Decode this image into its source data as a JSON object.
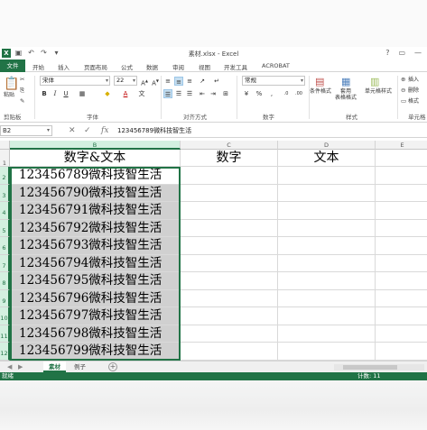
{
  "window": {
    "app_icon": "X",
    "title": "素材.xlsx - Excel",
    "controls": [
      "?",
      "▭",
      "—"
    ]
  },
  "quick_access": {
    "icons": [
      "save-icon",
      "undo-icon",
      "redo-icon",
      "customize-icon"
    ]
  },
  "ribbon": {
    "tabs": [
      "文件",
      "开始",
      "插入",
      "页面布局",
      "公式",
      "数据",
      "审阅",
      "视图",
      "开发工具",
      "ACROBAT"
    ],
    "active_tab": "开始",
    "clipboard": {
      "paste_label": "粘贴",
      "group_label": "剪贴板"
    },
    "font": {
      "name": "宋体",
      "size": "22",
      "group_label": "字体"
    },
    "alignment": {
      "group_label": "对齐方式"
    },
    "number": {
      "format": "常规",
      "group_label": "数字"
    },
    "styles": {
      "conditional": "条件格式",
      "table": "套用\n表格格式",
      "cell": "单元格样式",
      "group_label": "样式"
    },
    "cells": {
      "insert": "插入",
      "delete": "删除",
      "format": "格式",
      "group_label": "单元格"
    }
  },
  "formula_bar": {
    "name_box": "B2",
    "fx": "fx",
    "value": "123456789微科技智生活"
  },
  "grid": {
    "columns": [
      "B",
      "C",
      "D",
      "E"
    ],
    "rows": [
      "1",
      "2",
      "3",
      "4",
      "5",
      "6",
      "7",
      "8",
      "9",
      "10",
      "11",
      "12"
    ],
    "header_row": [
      "数字&文本",
      "数字",
      "文本",
      ""
    ],
    "b_values": [
      "123456789微科技智生活",
      "123456790微科技智生活",
      "123456791微科技智生活",
      "123456792微科技智生活",
      "123456793微科技智生活",
      "123456794微科技智生活",
      "123456795微科技智生活",
      "123456796微科技智生活",
      "123456797微科技智生活",
      "123456798微科技智生活",
      "123456799微科技智生活"
    ]
  },
  "sheets": {
    "tabs": [
      "素材",
      "例子"
    ],
    "active": "素材"
  },
  "status": {
    "left": "就绪",
    "right": "计数: 11"
  },
  "colors": {
    "excel_green": "#217346",
    "selection_gray": "#d0d0d0"
  }
}
